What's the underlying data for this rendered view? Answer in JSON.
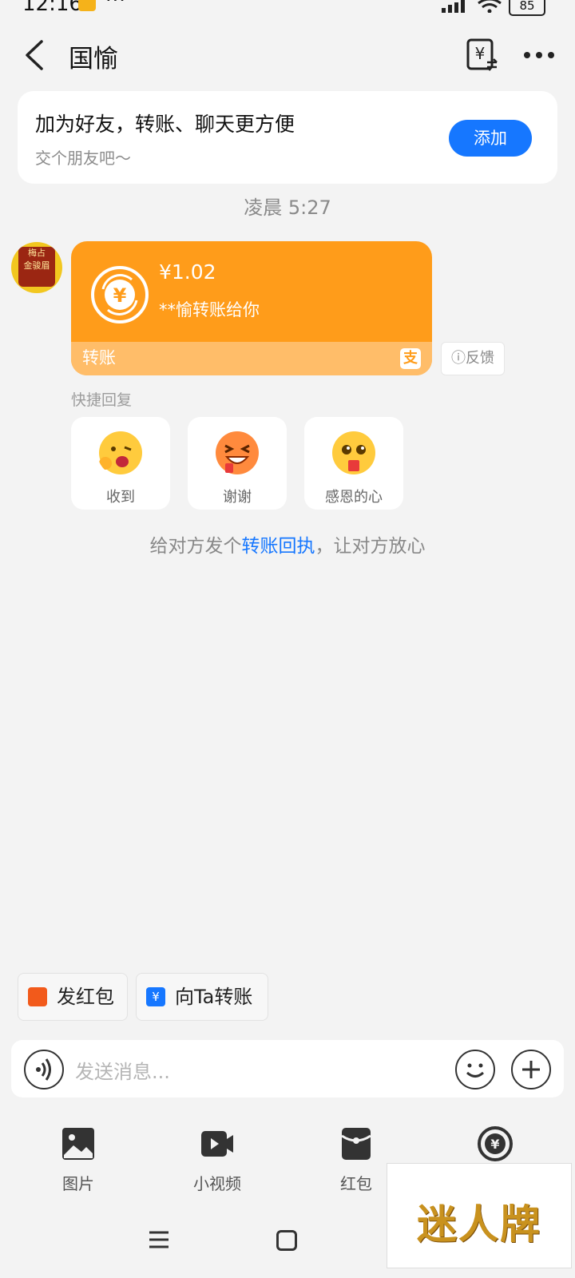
{
  "status_bar": {
    "time": "12:16",
    "more": "···",
    "battery": "85"
  },
  "header": {
    "title": "国愉"
  },
  "friend_card": {
    "main": "加为好友，转账、聊天更方便",
    "sub": "交个朋友吧～",
    "button": "添加"
  },
  "timestamp": "凌晨 5:27",
  "avatar": {
    "line1": "梅占",
    "line2": "金骏眉"
  },
  "transfer": {
    "amount": "¥1.02",
    "note": "**愉转账给你",
    "label": "转账",
    "feedback": "反馈"
  },
  "quick_reply": {
    "title": "快捷回复",
    "items": [
      {
        "label": "收到"
      },
      {
        "label": "谢谢"
      },
      {
        "label": "感恩的心"
      }
    ]
  },
  "receipt_hint": {
    "before": "给对方发个",
    "link": "转账回执",
    "after": "，让对方放心"
  },
  "chips": {
    "red_packet": "发红包",
    "transfer": "向Ta转账"
  },
  "input": {
    "placeholder": "发送消息..."
  },
  "tools": [
    {
      "label": "图片"
    },
    {
      "label": "小视频"
    },
    {
      "label": "红包"
    }
  ],
  "watermark": "迷人牌",
  "colors": {
    "accent_blue": "#1677ff",
    "transfer_orange": "#ff9c1a"
  }
}
